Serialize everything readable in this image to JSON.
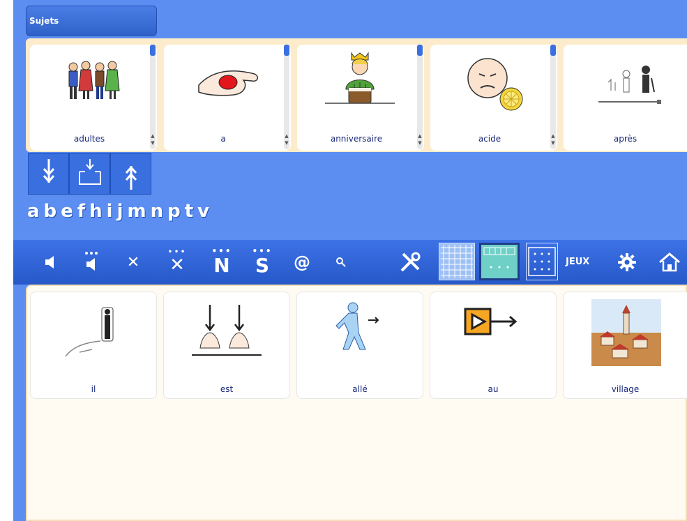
{
  "subjects_button": {
    "label": "Sujets"
  },
  "picto_strip": {
    "cards": [
      {
        "label": "adultes",
        "icon": "adults-icon"
      },
      {
        "label": "a",
        "icon": "hand-ball-icon"
      },
      {
        "label": "anniversaire",
        "icon": "birthday-cake-icon"
      },
      {
        "label": "acide",
        "icon": "sour-lemon-face-icon"
      },
      {
        "label": "après",
        "icon": "after-timeline-icon"
      }
    ]
  },
  "nav_buttons": [
    {
      "icon": "arrow-down-icon"
    },
    {
      "icon": "place-in-box-icon"
    },
    {
      "icon": "arrow-up-icon"
    }
  ],
  "letters": [
    "a",
    "b",
    "e",
    "f",
    "h",
    "i",
    "j",
    "m",
    "n",
    "p",
    "t",
    "v"
  ],
  "toolbar": {
    "items": [
      {
        "icon": "speaker-icon"
      },
      {
        "icon": "speak-all-icon"
      },
      {
        "icon": "delete-icon",
        "glyph": "✕"
      },
      {
        "icon": "delete-all-icon",
        "glyph": "✕"
      },
      {
        "icon": "n-icon",
        "glyph": "N"
      },
      {
        "icon": "s-icon",
        "glyph": "S"
      },
      {
        "icon": "at-icon",
        "glyph": "@"
      },
      {
        "icon": "search-icon"
      },
      {
        "icon": "tools-icon"
      },
      {
        "icon": "grid-large-icon"
      },
      {
        "icon": "grid-medium-icon"
      },
      {
        "icon": "grid-small-icon"
      },
      {
        "icon": "games-label",
        "label": "JEUX"
      },
      {
        "icon": "gear-icon"
      },
      {
        "icon": "home-icon"
      }
    ]
  },
  "sentence": {
    "cards": [
      {
        "label": "il",
        "icon": "he-pointing-icon"
      },
      {
        "label": "est",
        "icon": "is-hands-icon"
      },
      {
        "label": "allé",
        "icon": "walking-man-icon"
      },
      {
        "label": "au",
        "icon": "to-arrow-icon"
      },
      {
        "label": "village",
        "icon": "village-icon"
      }
    ]
  },
  "colors": {
    "background": "#5b8ef0",
    "toolbar": "#2c5fcf",
    "strip": "#fdeccc",
    "label_text": "#1b2a7a",
    "selected_grid": "#6fd0c8"
  }
}
